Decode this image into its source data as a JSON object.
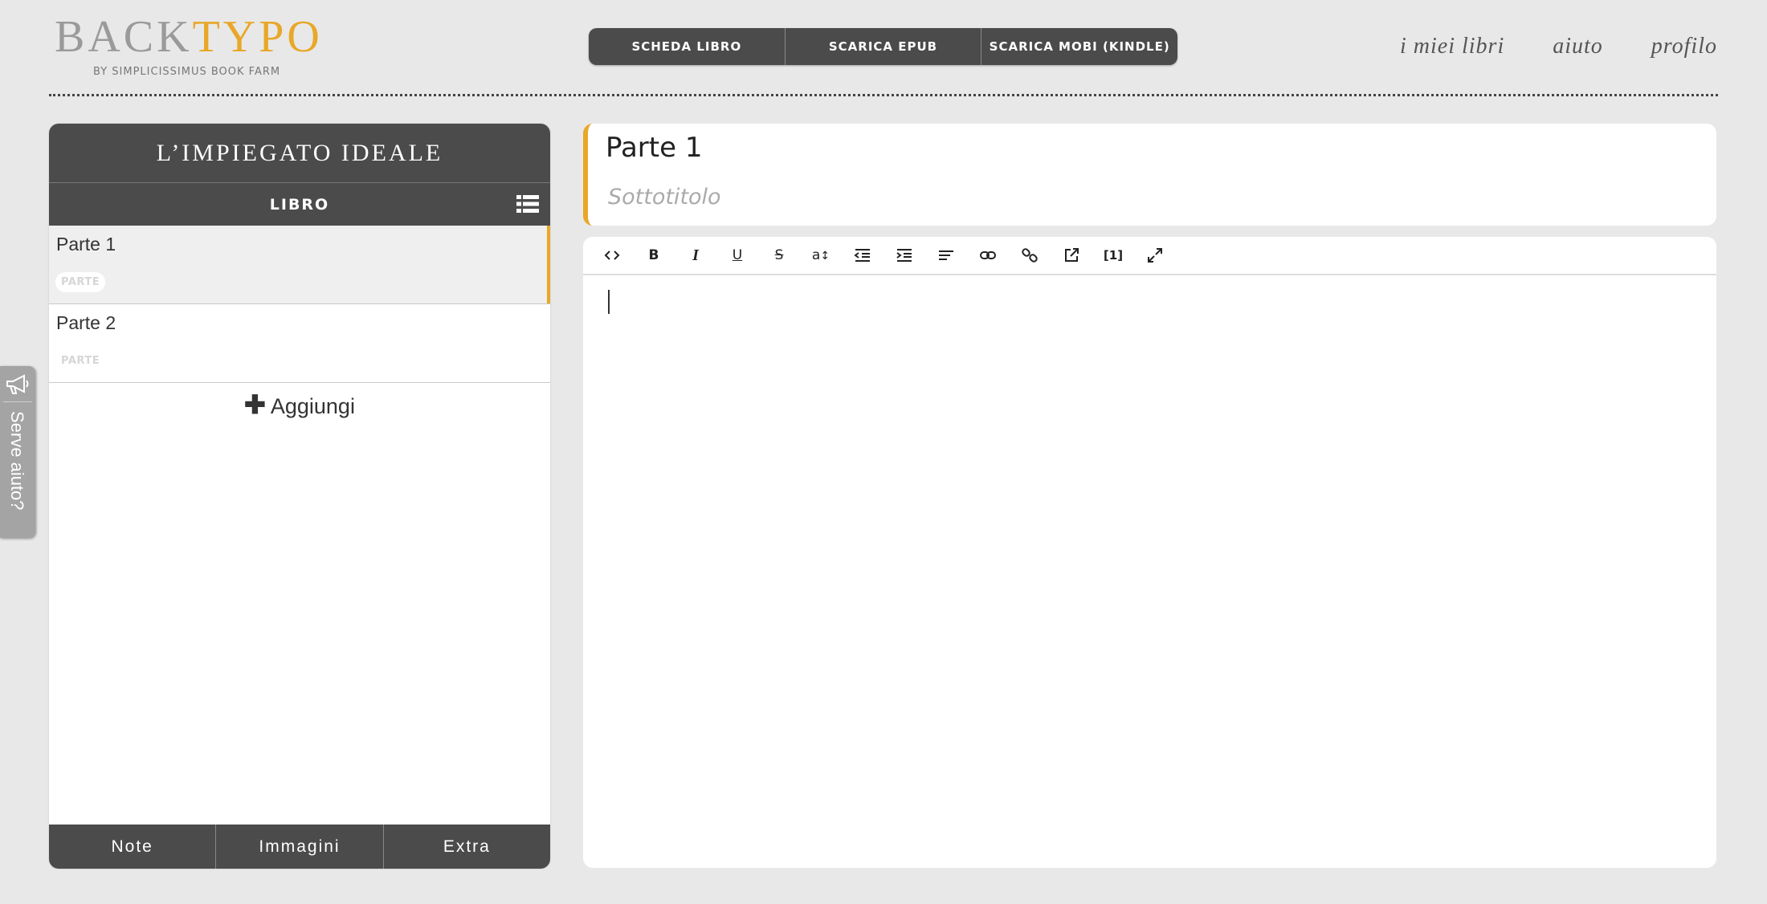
{
  "header": {
    "logo_back": "BACK",
    "logo_typo": "TYPO",
    "logo_sub": "BY SIMPLICISSIMUS BOOK FARM",
    "buttons": [
      "SCHEDA LIBRO",
      "SCARICA EPUB",
      "SCARICA MOBI (KINDLE)"
    ],
    "nav": [
      "i miei libri",
      "aiuto",
      "profilo"
    ]
  },
  "sidebar": {
    "book_title": "L’IMPIEGATO IDEALE",
    "section_label": "LIBRO",
    "chapters": [
      {
        "title": "Parte 1",
        "type": "PARTE",
        "active": true
      },
      {
        "title": "Parte 2",
        "type": "PARTE",
        "active": false
      }
    ],
    "add_label": "Aggiungi",
    "bottom_tabs": [
      "Note",
      "Immagini",
      "Extra"
    ]
  },
  "help": {
    "label": "Serve aiuto?"
  },
  "editor": {
    "title_value": "Parte 1",
    "subtitle_placeholder": "Sottotitolo",
    "toolbar": [
      {
        "name": "code-view",
        "icon": "code-icon"
      },
      {
        "name": "bold",
        "icon": "bold-icon",
        "glyph": "B"
      },
      {
        "name": "italic",
        "icon": "italic-icon",
        "glyph": "I"
      },
      {
        "name": "underline",
        "icon": "underline-icon",
        "glyph": "U"
      },
      {
        "name": "strikethrough",
        "icon": "strikethrough-icon",
        "glyph": "S"
      },
      {
        "name": "font-size",
        "icon": "font-size-icon",
        "glyph": "a"
      },
      {
        "name": "outdent",
        "icon": "outdent-icon"
      },
      {
        "name": "indent",
        "icon": "indent-icon"
      },
      {
        "name": "align",
        "icon": "align-left-icon"
      },
      {
        "name": "link",
        "icon": "link-icon"
      },
      {
        "name": "unlink",
        "icon": "unlink-icon"
      },
      {
        "name": "external-link",
        "icon": "external-link-icon"
      },
      {
        "name": "footnote",
        "icon": "footnote-icon",
        "glyph": "[1]"
      },
      {
        "name": "fullscreen",
        "icon": "expand-icon"
      }
    ]
  },
  "colors": {
    "accent": "#e8a728",
    "dark": "#4b4b4b",
    "background": "#e8e8e8"
  }
}
